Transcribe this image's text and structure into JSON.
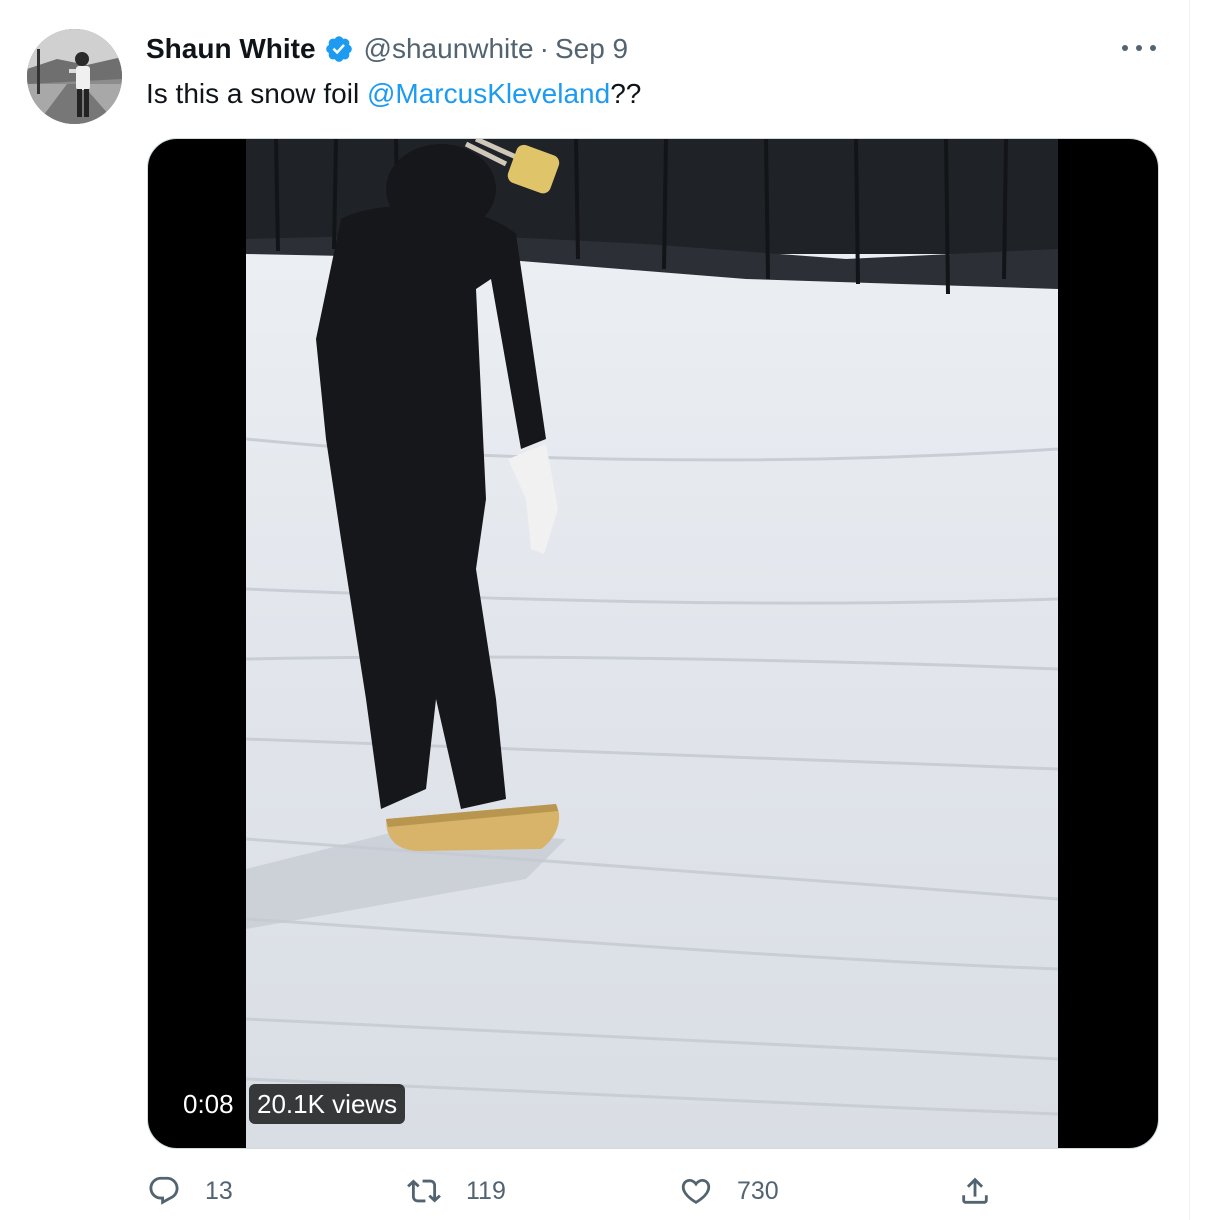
{
  "tweet": {
    "author_name": "Shaun White",
    "author_handle": "@shaunwhite",
    "separator": "·",
    "date": "Sep 9",
    "text_prefix": "Is this a snow foil ",
    "mention": "@MarcusKleveland",
    "text_suffix": "??",
    "verified": true
  },
  "media": {
    "type": "video",
    "duration": "0:08",
    "views": "20.1K views"
  },
  "actions": {
    "reply_count": "13",
    "retweet_count": "119",
    "like_count": "730"
  },
  "icons": {
    "verified": "verified-badge-icon",
    "more": "more-icon",
    "reply": "reply-icon",
    "retweet": "retweet-icon",
    "like": "heart-icon",
    "share": "share-icon"
  },
  "colors": {
    "accent": "#1d9bf0",
    "text_primary": "#0f1419",
    "text_secondary": "#536471"
  }
}
